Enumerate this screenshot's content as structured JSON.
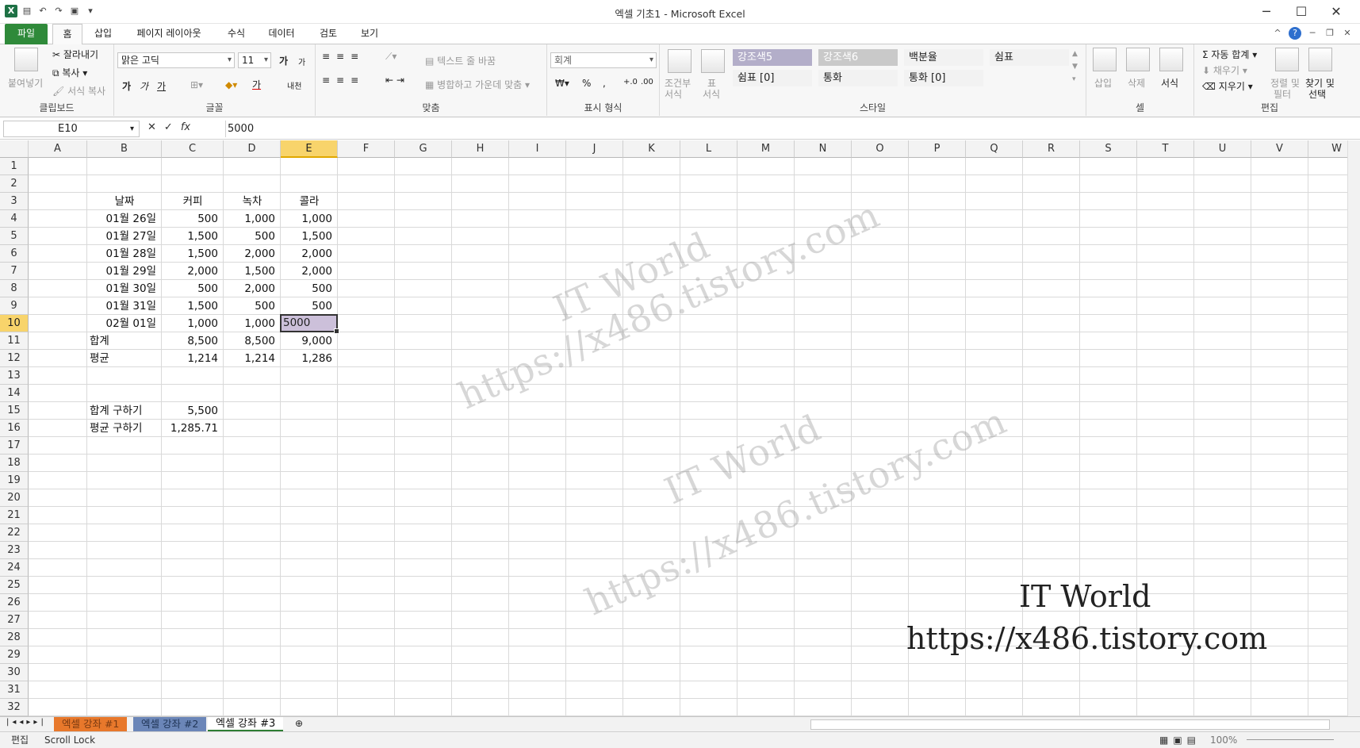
{
  "window": {
    "title": "엑셀 기초1 - Microsoft Excel",
    "logo": "X"
  },
  "ribbon_tabs": [
    "파일",
    "홈",
    "삽입",
    "페이지 레이아웃",
    "수식",
    "데이터",
    "검토",
    "보기"
  ],
  "clipboard": {
    "paste": "붙여넣기",
    "cut": "잘라내기",
    "copy": "복사",
    "format_painter": "서식 복사",
    "label": "클립보드"
  },
  "font": {
    "name": "맑은 고딕",
    "size": "11",
    "grow": "가",
    "shrink": "가",
    "bold": "가",
    "italic": "가",
    "underline": "가",
    "color_a": "가",
    "phonetic": "내천",
    "label": "글꼴"
  },
  "alignment": {
    "wrap": "텍스트 줄 바꿈",
    "merge": "병합하고 가운데 맞춤",
    "label": "맞춤"
  },
  "number": {
    "format": "회계",
    "pct": "%",
    "comma": ",",
    "inc": "+.0",
    "dec": ".00",
    "label": "표시 형식"
  },
  "styles": {
    "cond": "조건부",
    "cond2": "서식",
    "table": "표",
    "table2": "서식",
    "cells": [
      [
        "강조색5",
        "강조색6",
        "백분율",
        "쉼표"
      ],
      [
        "쉼표 [0]",
        "통화",
        "통화 [0]"
      ]
    ],
    "label": "스타일"
  },
  "cells_grp": {
    "insert": "삽입",
    "delete": "삭제",
    "format": "서식",
    "label": "셀"
  },
  "editing": {
    "autosum": "Σ 자동 합계",
    "fill": "채우기",
    "clear": "지우기",
    "sort": "정렬 및",
    "sort2": "필터",
    "find": "찾기 및",
    "find2": "선택",
    "label": "편집"
  },
  "formula": {
    "namebox": "E10",
    "fx": "fx",
    "value": "5000"
  },
  "columns": [
    "A",
    "B",
    "C",
    "D",
    "E",
    "F",
    "G",
    "H",
    "I",
    "J",
    "K",
    "L",
    "M",
    "N",
    "O",
    "P",
    "Q",
    "R",
    "S",
    "T",
    "U",
    "V",
    "W"
  ],
  "rows": [
    "1",
    "2",
    "3",
    "4",
    "5",
    "6",
    "7",
    "8",
    "9",
    "10",
    "11",
    "12",
    "13",
    "14",
    "15",
    "16",
    "17",
    "18",
    "19",
    "20",
    "21",
    "22",
    "23",
    "24",
    "25",
    "26",
    "27",
    "28",
    "29",
    "30",
    "31",
    "32"
  ],
  "table": {
    "headers": [
      "날짜",
      "커피",
      "녹차",
      "콜라"
    ],
    "data": [
      [
        "01월 26일",
        "500",
        "1,000",
        "1,000"
      ],
      [
        "01월 27일",
        "1,500",
        "500",
        "1,500"
      ],
      [
        "01월 28일",
        "1,500",
        "2,000",
        "2,000"
      ],
      [
        "01월 29일",
        "2,000",
        "1,500",
        "2,000"
      ],
      [
        "01월 30일",
        "500",
        "2,000",
        "500"
      ],
      [
        "01월 31일",
        "1,500",
        "500",
        "500"
      ],
      [
        "02월 01일",
        "1,000",
        "1,000",
        "5000"
      ]
    ],
    "sum": [
      "합계",
      "8,500",
      "8,500",
      "9,000"
    ],
    "avg": [
      "평균",
      "1,214",
      "1,214",
      "1,286"
    ],
    "calc_sum": [
      "합계 구하기",
      "5,500"
    ],
    "calc_avg": [
      "평균 구하기",
      "1,285.71"
    ]
  },
  "watermark": {
    "line1": "IT World",
    "line2": "https://x486.tistory.com"
  },
  "sheets": [
    "엑셀 강좌 #1",
    "엑셀 강좌 #2",
    "엑셀 강좌 #3"
  ],
  "status": {
    "mode": "편집",
    "scroll_lock": "Scroll Lock",
    "zoom": "100%"
  }
}
